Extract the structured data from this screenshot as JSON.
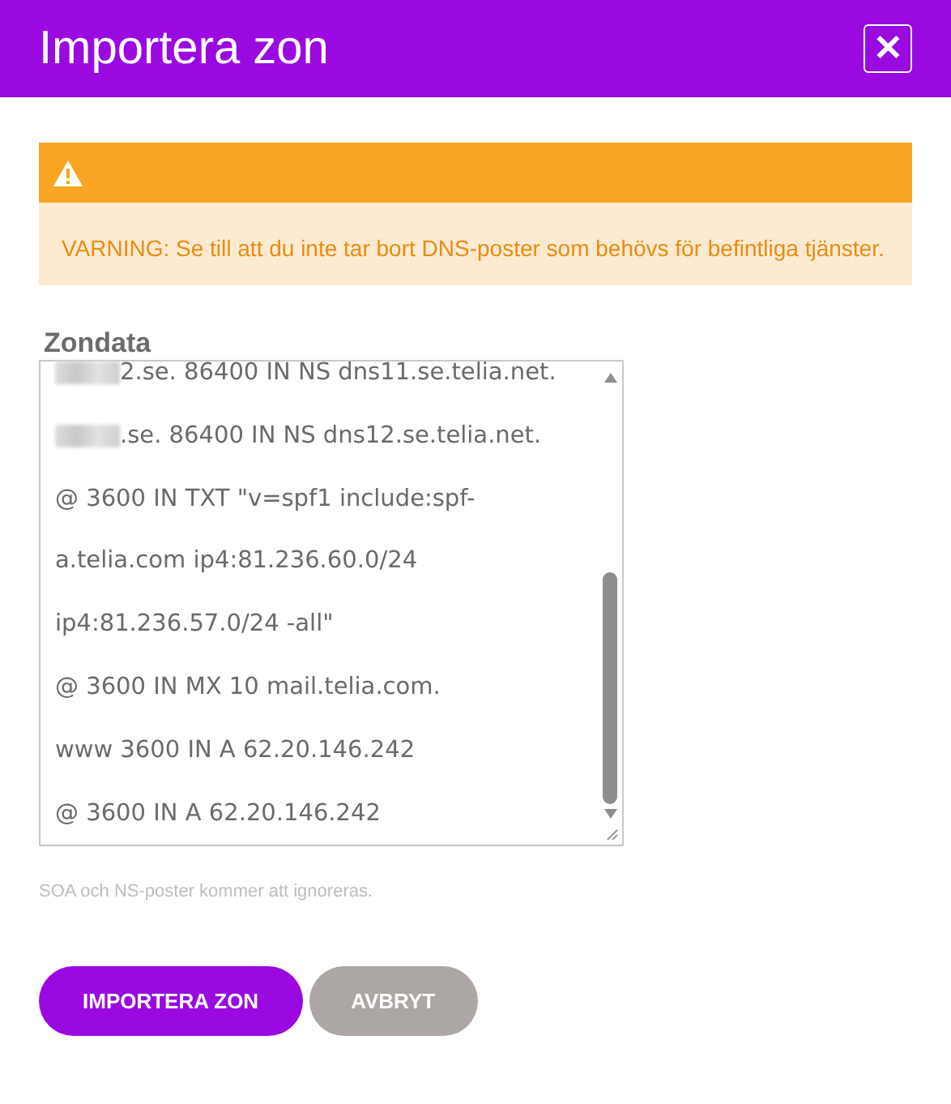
{
  "dialog": {
    "title": "Importera zon",
    "close": "✕"
  },
  "warning": {
    "text": "VARNING: Se till att du inte tar bort DNS-poster som behövs för befintliga tjänster."
  },
  "zone_data": {
    "label": "Zondata",
    "lines": [
      {
        "text": "2.se. 86400 IN NS dns11.se.telia.net.",
        "redacted": true
      },
      {
        "text": ".se. 86400 IN NS dns12.se.telia.net.",
        "redacted": true
      },
      {
        "text": "@ 3600 IN TXT \"v=spf1 include:spf-",
        "redacted": false
      },
      {
        "text": "a.telia.com ip4:81.236.60.0/24",
        "redacted": false
      },
      {
        "text": "ip4:81.236.57.0/24 -all\"",
        "redacted": false
      },
      {
        "text": "@ 3600 IN MX 10 mail.telia.com.",
        "redacted": false
      },
      {
        "text": "www 3600 IN A 62.20.146.242",
        "redacted": false
      },
      {
        "text": "@ 3600 IN A 62.20.146.242",
        "redacted": false
      }
    ],
    "hint": "SOA och NS-poster kommer att ignoreras."
  },
  "buttons": [
    {
      "label": "IMPORTERA ZON",
      "kind": "primary"
    },
    {
      "label": "AVBRYT",
      "kind": "secondary"
    }
  ]
}
